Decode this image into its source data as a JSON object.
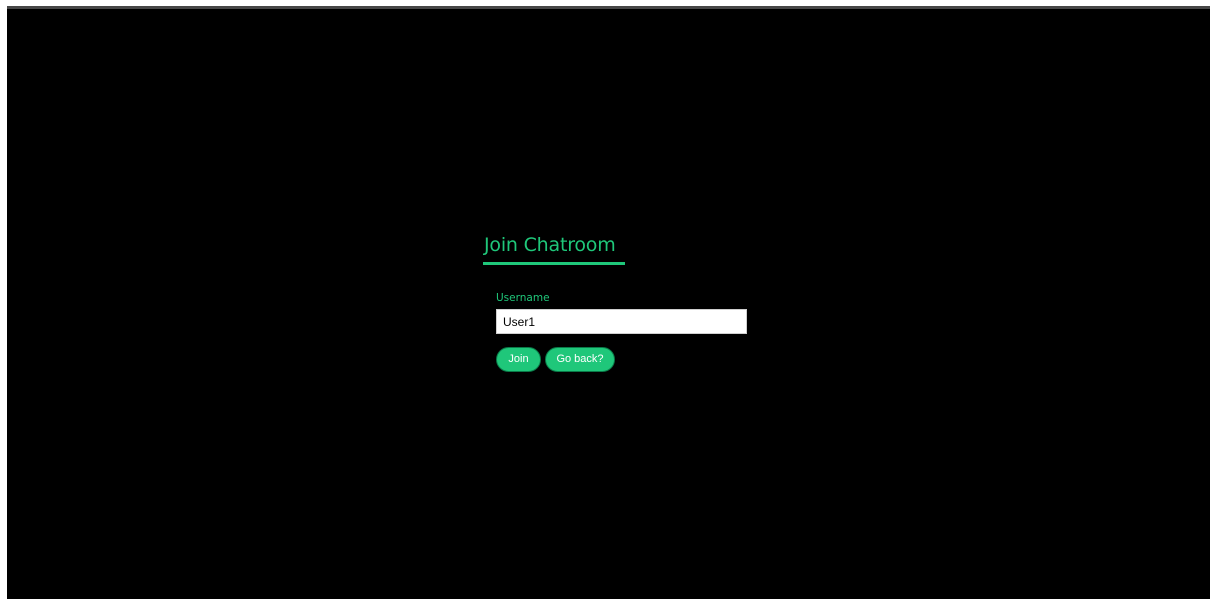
{
  "page": {
    "title": "Join Chatroom"
  },
  "form": {
    "username_label": "Username",
    "username_value": "User1",
    "join_label": "Join",
    "back_label": "Go back?"
  },
  "colors": {
    "accent": "#1fc77a",
    "background": "#000000",
    "top_bar": "#474747"
  }
}
